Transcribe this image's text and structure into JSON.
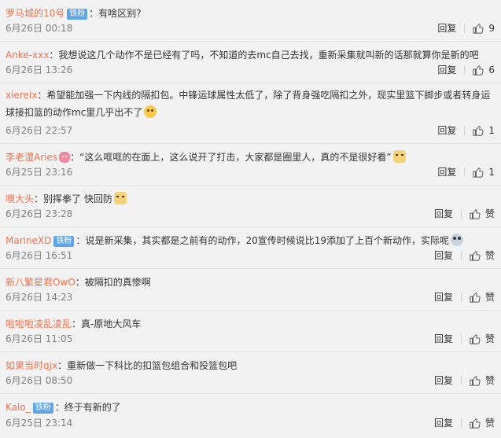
{
  "reply_label": "回复",
  "like_placeholder": "赞",
  "comments": [
    {
      "user": "罗马城的10号",
      "badge": "铁粉",
      "text": "有啥区别?",
      "time": "6月26日 00:18",
      "likes": "9"
    },
    {
      "user": "Anke-xxx",
      "badge": "",
      "text": "我想说这几个动作不是已经有了吗，不知道的去mc自己去找，重新采集就叫新的话那就算你是新的吧",
      "time": "6月26日 13:26",
      "likes": "6"
    },
    {
      "user": "xiereix",
      "badge": "",
      "text": "希望能加强一下内线的隔扣包。中锋运球属性太低了，除了背身强吃隔扣之外，现实里篮下脚步或者转身运球接扣篮的动作mc里几乎出不了",
      "emoji": "yellow-face-icon",
      "time": "6月26日 22:57",
      "likes": "1"
    },
    {
      "user": "李老湿Aries",
      "badge": "",
      "text": "“这么哐哐的在面上，这么说开了打击，大家都是圈里人，真的不是很好看”",
      "user_emoji": "pink-face-icon",
      "emoji": "dog-face-icon",
      "time": "6月25日 23:16",
      "likes": "1"
    },
    {
      "user": "噢大头",
      "badge": "",
      "text": "别挥拳了  快回防",
      "emoji": "dog-face-icon",
      "time": "6月26日 23:28",
      "likes": "赞"
    },
    {
      "user": "MarineXD",
      "badge": "铁粉",
      "text": "说是新采集，其实都是之前有的动作，20宣传时候说比19添加了上百个新动作，实际呢",
      "emoji": "grey-face-icon",
      "time": "6月26日 16:51",
      "likes": "赞"
    },
    {
      "user": "新八繁星君OwO",
      "badge": "",
      "text": "被隔扣的真惨啊",
      "time": "6月26日 14:23",
      "likes": "赞"
    },
    {
      "user": "啦啦啦凌乱凌乱",
      "badge": "",
      "text": "真-原地大风车",
      "time": "6月26日 11:05",
      "likes": "赞"
    },
    {
      "user": "如果当时qjx",
      "badge": "",
      "text": "重新做一下科比的扣篮包组合和投篮包吧",
      "time": "6月26日 08:50",
      "likes": "赞"
    },
    {
      "user": "Kalo_",
      "badge": "铁粉",
      "text": "终于有新的了",
      "time": "6月25日 23:14",
      "likes": "赞"
    }
  ]
}
